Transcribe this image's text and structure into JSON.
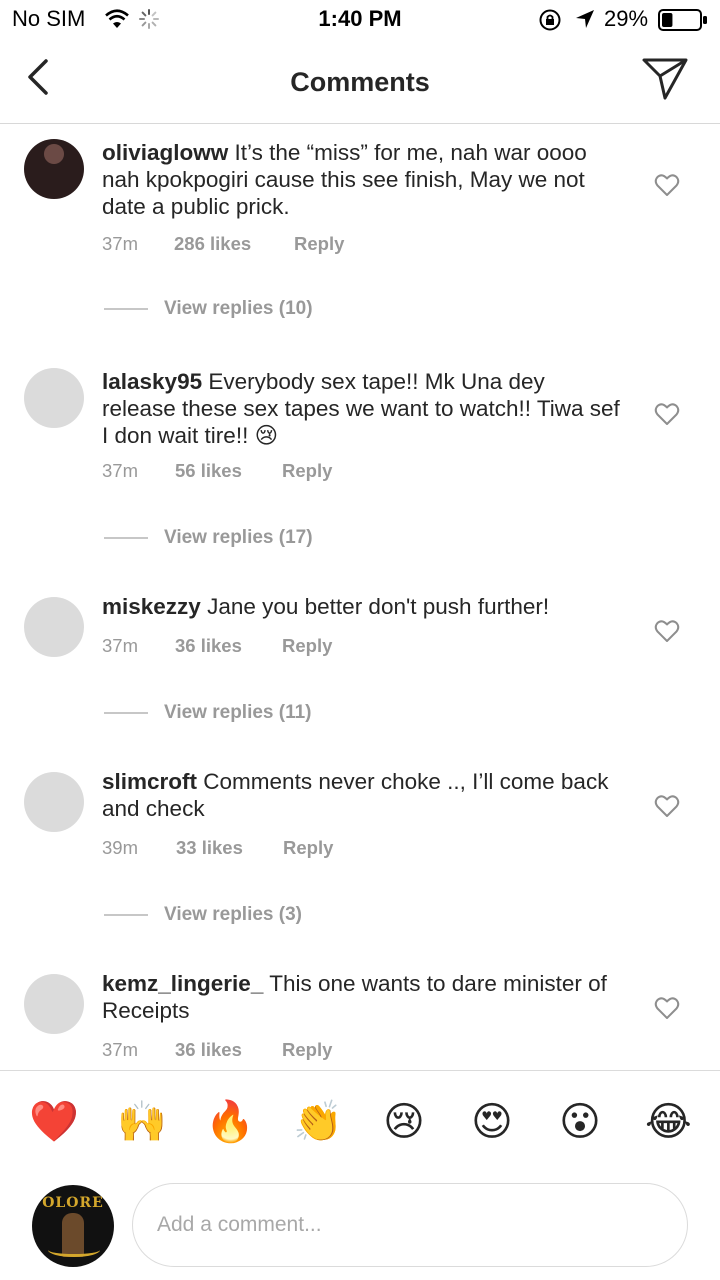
{
  "status_bar": {
    "carrier": "No SIM",
    "time": "1:40 PM",
    "battery_percent": "29%",
    "battery_level": 0.29
  },
  "nav": {
    "title": "Comments",
    "back_icon": "chevron-left-icon",
    "send_icon": "paper-plane-icon"
  },
  "comments": [
    {
      "username": "oliviagloww",
      "text": "It’s the “miss” for me, nah war oooo nah kpokpogiri cause this see finish, May we not date a public prick.",
      "time": "37m",
      "likes": "286 likes",
      "reply": "Reply",
      "view_replies": "View replies (10)"
    },
    {
      "username": "lalasky95",
      "text": "Everybody sex tape!! Mk Una dey release these sex tapes we want to watch!! Tiwa sef I don wait tire!! 😢",
      "time": "37m",
      "likes": "56 likes",
      "reply": "Reply",
      "view_replies": "View replies (17)"
    },
    {
      "username": "miskezzy",
      "text": "Jane you better don't push further!",
      "time": "37m",
      "likes": "36 likes",
      "reply": "Reply",
      "view_replies": "View replies (11)"
    },
    {
      "username": "slimcroft",
      "text": "Comments never choke .., I’ll come back and check",
      "time": "39m",
      "likes": "33 likes",
      "reply": "Reply",
      "view_replies": "View replies (3)"
    },
    {
      "username": "kemz_lingerie_",
      "text": "This one wants to dare minister of Receipts",
      "time": "37m",
      "likes": "36 likes",
      "reply": "Reply"
    }
  ],
  "emoji_bar": [
    {
      "emoji": "❤️",
      "name": "red-heart"
    },
    {
      "emoji": "🙌",
      "name": "raising-hands"
    },
    {
      "emoji": "🔥",
      "name": "fire"
    },
    {
      "emoji": "👏",
      "name": "clapping-hands"
    },
    {
      "emoji": "😢",
      "name": "crying-face"
    },
    {
      "emoji": "😍",
      "name": "heart-eyes"
    },
    {
      "emoji": "😮",
      "name": "surprised-face"
    },
    {
      "emoji": "😂",
      "name": "tears-of-joy"
    }
  ],
  "composer": {
    "placeholder": "Add a comment...",
    "avatar_logo_text": "OLORE"
  }
}
